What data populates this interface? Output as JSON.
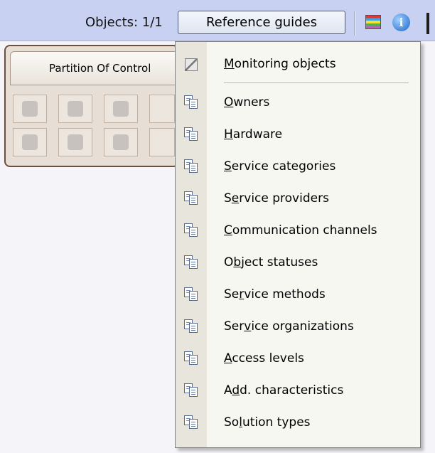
{
  "toolbar": {
    "objects_label": "Objects: 1/1",
    "reference_button": "Reference guides",
    "icons": [
      "color-grid-icon",
      "info-icon"
    ]
  },
  "partition": {
    "title": "Partition Of Control"
  },
  "menu": {
    "items": [
      {
        "pre": "",
        "mn": "M",
        "post": "onitoring objects",
        "icon": "monitoring-objects-icon"
      },
      {
        "pre": "",
        "mn": "O",
        "post": "wners",
        "icon": "document-icon"
      },
      {
        "pre": "",
        "mn": "H",
        "post": "ardware",
        "icon": "document-icon"
      },
      {
        "pre": "",
        "mn": "S",
        "post": "ervice categories",
        "icon": "document-icon"
      },
      {
        "pre": "S",
        "mn": "e",
        "post": "rvice providers",
        "icon": "document-icon"
      },
      {
        "pre": "",
        "mn": "C",
        "post": "ommunication channels",
        "icon": "document-icon"
      },
      {
        "pre": "O",
        "mn": "b",
        "post": "ject statuses",
        "icon": "document-icon"
      },
      {
        "pre": "Se",
        "mn": "r",
        "post": "vice methods",
        "icon": "document-icon"
      },
      {
        "pre": "Ser",
        "mn": "v",
        "post": "ice organizations",
        "icon": "document-icon"
      },
      {
        "pre": "",
        "mn": "A",
        "post": "ccess levels",
        "icon": "document-icon"
      },
      {
        "pre": "A",
        "mn": "d",
        "post": "d. characteristics",
        "icon": "document-icon"
      },
      {
        "pre": "So",
        "mn": "l",
        "post": "ution types",
        "icon": "document-icon"
      }
    ]
  },
  "colors": {
    "toolbar_bg": "#c8d1f2",
    "menu_bg": "#f7f7f2",
    "menu_gutter": "#e8e6dc"
  }
}
